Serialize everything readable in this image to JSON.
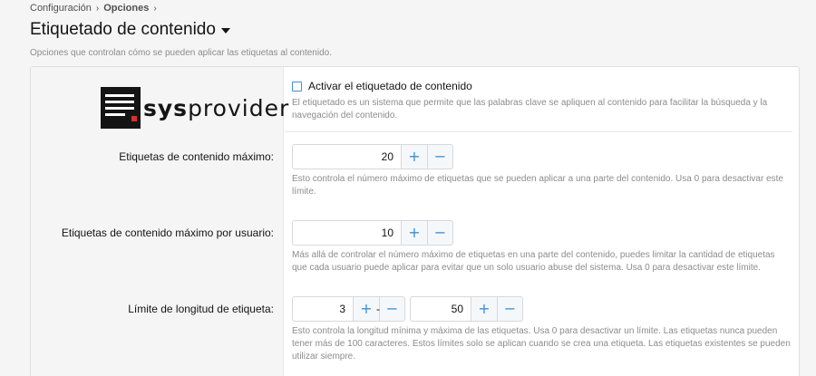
{
  "breadcrumb": [
    {
      "label": "Configuración"
    },
    {
      "label": "Opciones"
    }
  ],
  "breadcrumb_separator": "›",
  "page": {
    "title": "Etiquetado de contenido",
    "description": "Opciones que controlan cómo se pueden aplicar las etiquetas al contenido."
  },
  "logo": {
    "text_bold": "sys",
    "text_regular": "provider"
  },
  "enable_tagging": {
    "label": "Activar el etiquetado de contenido",
    "checked": false,
    "explain": "El etiquetado es un sistema que permite que las palabras clave se apliquen al contenido para facilitar la búsqueda y la navegación del contenido."
  },
  "max_tags": {
    "label": "Etiquetas de contenido máximo:",
    "value": "20",
    "explain": "Esto controla el número máximo de etiquetas que se pueden aplicar a una parte del contenido. Usa 0 para desactivar este límite."
  },
  "max_tags_per_user": {
    "label": "Etiquetas de contenido máximo por usuario:",
    "value": "10",
    "explain": "Más allá de controlar el número máximo de etiquetas en una parte del contenido, puedes limitar la cantidad de etiquetas que cada usuario puede aplicar para evitar que un solo usuario abuse del sistema. Usa 0 para desactivar este límite."
  },
  "tag_length": {
    "label": "Límite de longitud de etiqueta:",
    "min_value": "3",
    "max_value": "50",
    "separator": "-",
    "explain": "Esto controla la longitud mínima y máxima de las etiquetas. Usa 0 para desactivar un límite. Las etiquetas nunca pueden tener más de 100 caracteres. Estos límites solo se aplican cuando se crea una etiqueta. Las etiquetas existentes se pueden utilizar siempre."
  },
  "spinner": {
    "plus": "+",
    "minus": "−"
  },
  "colors": {
    "accent": "#3b8fd6",
    "text": "#141414",
    "muted": "#8c8c8c",
    "logo_red": "#d9302c"
  }
}
